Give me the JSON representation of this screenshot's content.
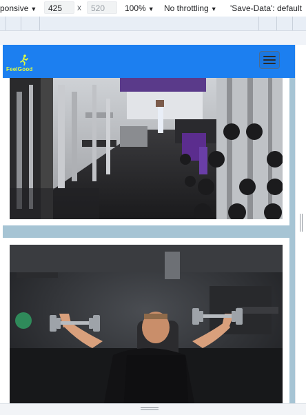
{
  "toolbar": {
    "device_label": "ponsive",
    "width_value": "425",
    "times_sign": "x",
    "height_placeholder": "520",
    "zoom_label": "100%",
    "throttle_label": "No throttling",
    "save_data_label": "'Save-Data': default",
    "dropdown_glyph": "▼"
  },
  "page": {
    "brand_text": "FeelGood",
    "brand_icon": "runner-icon",
    "menu_icon": "hamburger-menu-icon"
  },
  "images": [
    {
      "name": "gym-interior-photo",
      "subject": "gym equipment room"
    },
    {
      "name": "dumbbell-press-photo",
      "subject": "man doing dumbbell shoulder press"
    }
  ],
  "colors": {
    "navbar": "#1c7ff0",
    "brand_text": "#e6ff3a",
    "page_background": "#a6c4d4"
  }
}
